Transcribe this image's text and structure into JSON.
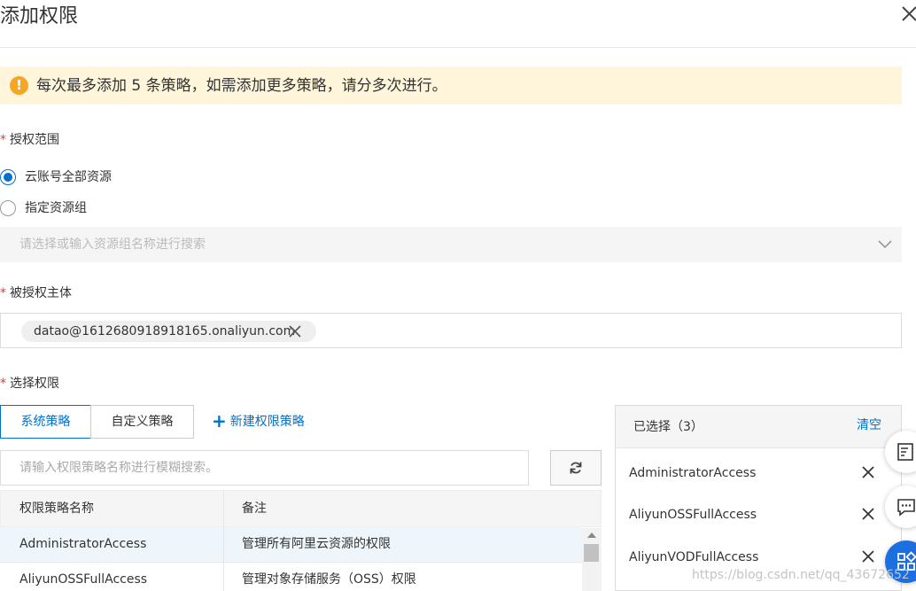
{
  "dialog": {
    "title": "添加权限"
  },
  "alert": {
    "icon": "!",
    "text": "每次最多添加 5 条策略，如需添加更多策略，请分多次进行。"
  },
  "scope": {
    "required_mark": "*",
    "label": "授权范围",
    "options": [
      {
        "label": "云账号全部资源",
        "checked": true
      },
      {
        "label": "指定资源组",
        "checked": false
      }
    ],
    "resource_group_placeholder": "请选择或输入资源组名称进行搜索"
  },
  "principal": {
    "required_mark": "*",
    "label": "被授权主体",
    "tag": "datao@1612680918918165.onaliyun.com"
  },
  "permissions": {
    "required_mark": "*",
    "label": "选择权限",
    "tabs": [
      "系统策略",
      "自定义策略"
    ],
    "new_policy_label": "新建权限策略",
    "search_placeholder": "请输入权限策略名称进行模糊搜索。",
    "table": {
      "columns": [
        "权限策略名称",
        "备注"
      ],
      "rows": [
        {
          "name": "AdministratorAccess",
          "note": "管理所有阿里云资源的权限"
        },
        {
          "name": "AliyunOSSFullAccess",
          "note": "管理对象存储服务（OSS）权限"
        }
      ]
    }
  },
  "selected_panel": {
    "title": "已选择（3）",
    "clear_label": "清空",
    "items": [
      "AdministratorAccess",
      "AliyunOSSFullAccess",
      "AliyunVODFullAccess"
    ]
  },
  "watermark": "https://blog.csdn.net/qq_43672652"
}
